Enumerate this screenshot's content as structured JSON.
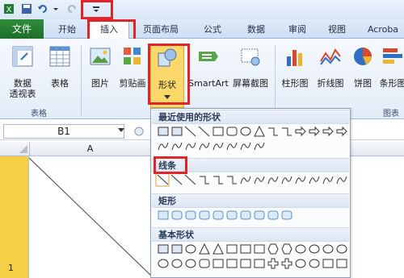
{
  "tabs": {
    "file": "文件",
    "home": "开始",
    "insert": "插入",
    "page_layout": "页面布局",
    "formulas": "公式",
    "data": "数据",
    "review": "审阅",
    "view": "视图",
    "acrobat": "Acroba"
  },
  "ribbon": {
    "pivot_label": "数据\n透视表",
    "pivot_line1": "数据",
    "pivot_line2": "透视表",
    "table": "表格",
    "picture": "图片",
    "clipart": "剪贴画",
    "shapes": "形状",
    "smartart": "SmartArt",
    "screenshot": "屏幕截图",
    "column_chart": "柱形图",
    "line_chart": "折线图",
    "pie_chart": "饼图",
    "bar_chart": "条形图",
    "group_tables": "表格",
    "group_charts": "图表"
  },
  "formula_bar": {
    "name_box": "B1"
  },
  "grid": {
    "col_a": "A",
    "row_1": "1"
  },
  "shapes_menu": {
    "recent": "最近使用的形状",
    "lines": "线条",
    "rectangles": "矩形",
    "basic": "基本形状"
  },
  "colors": {
    "accent_red": "#e0262a",
    "file_green": "#1f6e29",
    "shape_blue": "#5b8fd0"
  }
}
